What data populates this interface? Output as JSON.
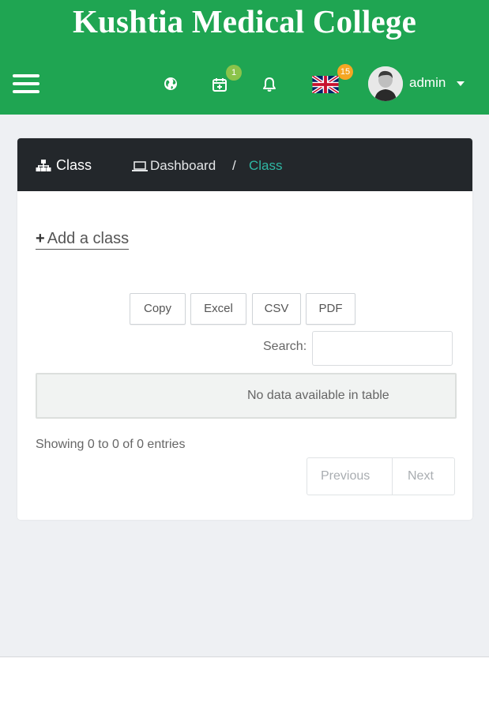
{
  "header": {
    "title": "Kushtia Medical College",
    "brand_color": "#1fa552",
    "icons": [
      "menu-icon",
      "globe-icon",
      "calendar-plus-icon",
      "bell-icon",
      "uk-flag-icon"
    ],
    "calendar_badge": "1",
    "language_badge": "15",
    "user": {
      "name": "admin"
    }
  },
  "page_header": {
    "title": "Class",
    "title_icon": "sitemap-icon",
    "breadcrumb": {
      "home": "Dashboard",
      "home_icon": "laptop-icon",
      "separator": "/",
      "current": "Class"
    },
    "accent_color": "#2fb7a4"
  },
  "main": {
    "add_link": {
      "icon": "+",
      "label": "Add a class"
    },
    "export_buttons": [
      "Copy",
      "Excel",
      "CSV",
      "PDF"
    ],
    "search": {
      "label": "Search:",
      "value": "",
      "placeholder": ""
    },
    "table": {
      "empty_message": "No data available in table"
    },
    "info": "Showing 0 to 0 of 0 entries",
    "pagination": {
      "previous": "Previous",
      "next": "Next"
    }
  }
}
